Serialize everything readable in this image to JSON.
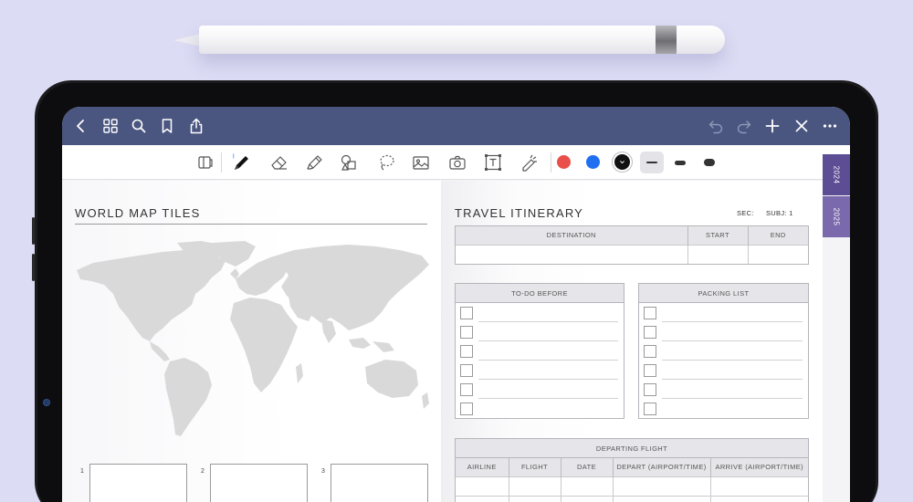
{
  "colors": {
    "background": "#dcdcf4",
    "navbar": "#4a5680",
    "tab_accent": "#7a69ad",
    "tab_accent_dark": "#5c4d94",
    "pen_red": "#e9504b",
    "pen_blue": "#1f6ff0",
    "pen_black": "#111111"
  },
  "navbar": {
    "left_icons": [
      "back-chevron-icon",
      "grid-icon",
      "search-icon",
      "bookmark-icon",
      "share-icon"
    ],
    "right_icons": [
      "undo-icon",
      "redo-icon",
      "add-icon",
      "close-icon",
      "more-icon"
    ]
  },
  "toolbar": {
    "tools": [
      "reader-mode-icon",
      "pen-icon",
      "eraser-icon",
      "highlighter-icon",
      "shapes-icon",
      "lasso-icon",
      "image-icon",
      "camera-icon",
      "text-icon",
      "laser-pointer-icon"
    ],
    "selected_tool": "pen-icon",
    "colors": [
      "#e9504b",
      "#1f6ff0",
      "#111111"
    ],
    "selected_color": "#111111",
    "stroke_sizes": [
      "thin",
      "medium",
      "thick"
    ],
    "selected_stroke": "thin"
  },
  "left_page": {
    "title": "WORLD MAP TILES",
    "tiles": [
      "1",
      "2",
      "3"
    ]
  },
  "right_page": {
    "title": "TRAVEL ITINERARY",
    "sec_label": "SEC:",
    "subj_label": "SUBJ: 1",
    "itinerary_columns": [
      "DESTINATION",
      "START",
      "END"
    ],
    "todo_title": "TO-DO BEFORE",
    "packing_title": "PACKING LIST",
    "list_rows": 6,
    "flight_title": "DEPARTING FLIGHT",
    "flight_columns": [
      "AIRLINE",
      "FLIGHT",
      "DATE",
      "DEPART (AIRPORT/TIME)",
      "ARRIVE (AIRPORT/TIME)"
    ]
  },
  "side_tabs": [
    "2024",
    "2025"
  ]
}
